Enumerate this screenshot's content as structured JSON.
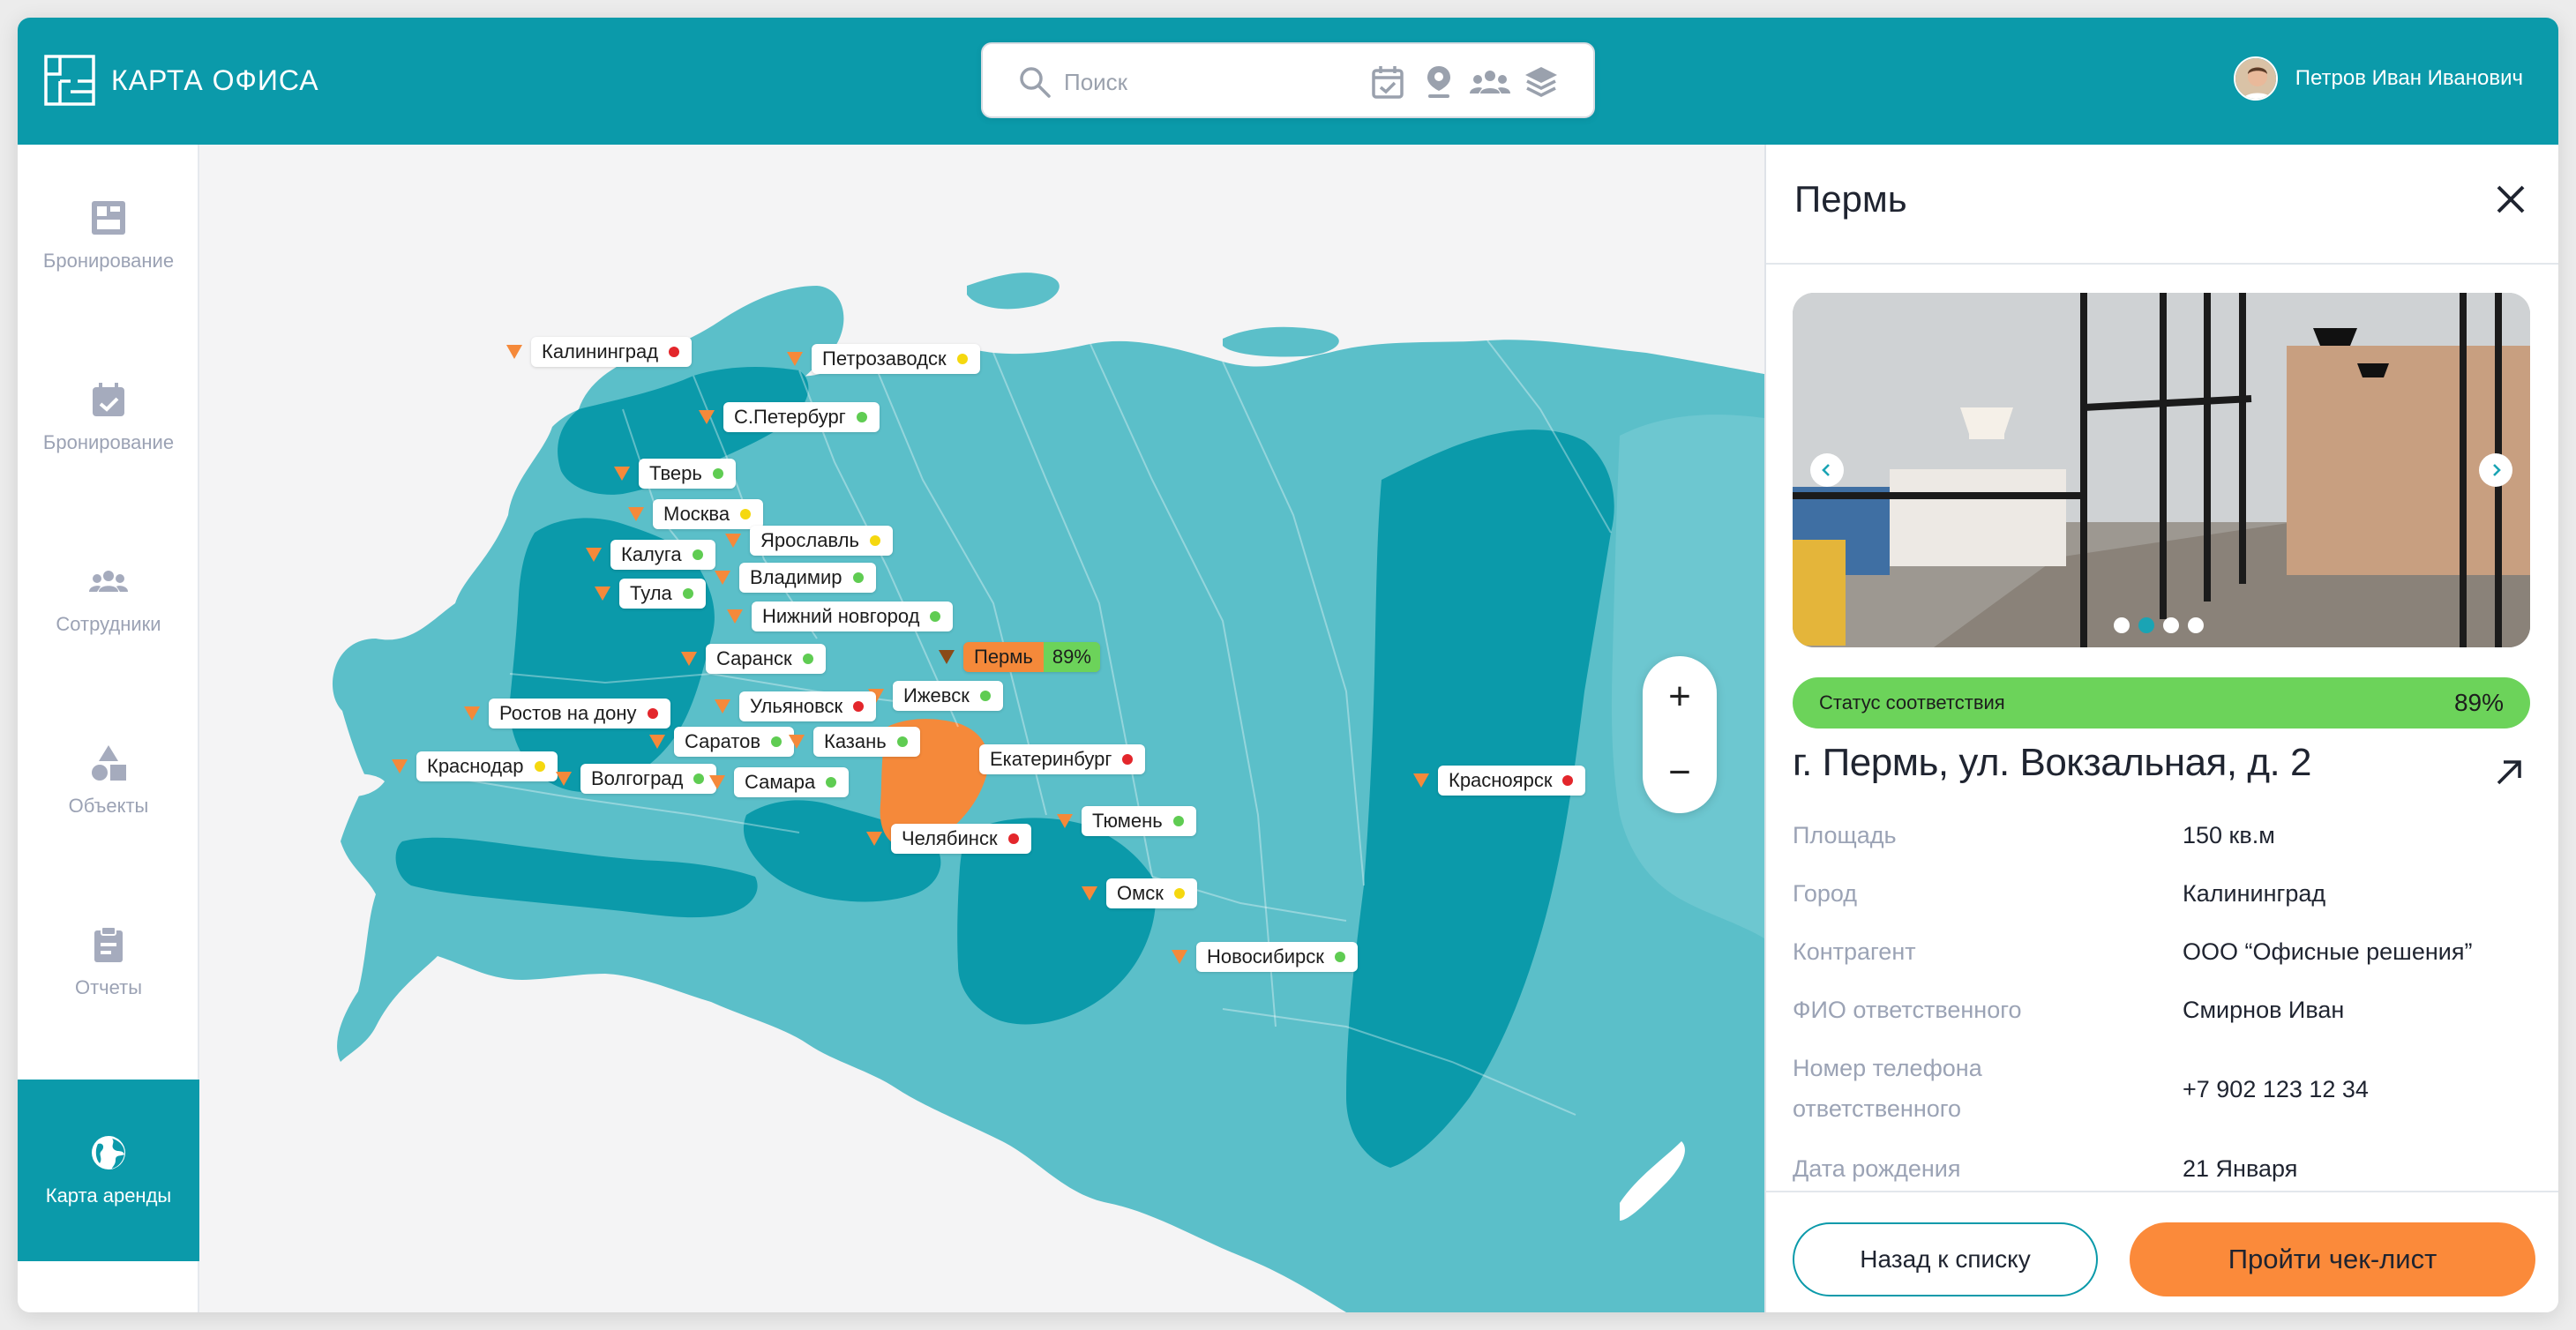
{
  "app": {
    "title": "КАРТА ОФИСА"
  },
  "search": {
    "placeholder": "Поиск",
    "tools": [
      "calendar-check-icon",
      "location-pin-icon",
      "people-icon",
      "layers-icon"
    ]
  },
  "user": {
    "name": "Петров Иван Иванович"
  },
  "sidebar": {
    "items": [
      {
        "label": "Бронирование",
        "icon": "floorplan-icon"
      },
      {
        "label": "Бронирование",
        "icon": "calendar-check-icon"
      },
      {
        "label": "Сотрудники",
        "icon": "people-icon"
      },
      {
        "label": "Объекты",
        "icon": "shapes-icon"
      },
      {
        "label": "Отчеты",
        "icon": "clipboard-icon"
      },
      {
        "label": "Карта аренды",
        "icon": "globe-icon",
        "active": true
      }
    ]
  },
  "map": {
    "cities": [
      {
        "name": "Калининград",
        "status": "red"
      },
      {
        "name": "Петрозаводск",
        "status": "yellow"
      },
      {
        "name": "С.Петербург",
        "status": "green"
      },
      {
        "name": "Тверь",
        "status": "green"
      },
      {
        "name": "Москва",
        "status": "yellow"
      },
      {
        "name": "Ярославль",
        "status": "yellow"
      },
      {
        "name": "Калуга",
        "status": "green"
      },
      {
        "name": "Владимир",
        "status": "green"
      },
      {
        "name": "Тула",
        "status": "green"
      },
      {
        "name": "Нижний новгород",
        "status": "green"
      },
      {
        "name": "Саранск",
        "status": "green"
      },
      {
        "name": "Пермь",
        "status": "selected",
        "percent": "89%"
      },
      {
        "name": "Ижевск",
        "status": "green"
      },
      {
        "name": "Ростов на дону",
        "status": "red"
      },
      {
        "name": "Ульяновск",
        "status": "red"
      },
      {
        "name": "Саратов",
        "status": "green"
      },
      {
        "name": "Казань",
        "status": "green"
      },
      {
        "name": "Екатеринбург",
        "status": "red"
      },
      {
        "name": "Краснодар",
        "status": "yellow"
      },
      {
        "name": "Волгоград",
        "status": "green"
      },
      {
        "name": "Самара",
        "status": "green"
      },
      {
        "name": "Красноярск",
        "status": "red"
      },
      {
        "name": "Тюмень",
        "status": "green"
      },
      {
        "name": "Челябинск",
        "status": "red"
      },
      {
        "name": "Омск",
        "status": "yellow"
      },
      {
        "name": "Новосибирск",
        "status": "green"
      }
    ],
    "zoom_in": "+",
    "zoom_out": "−"
  },
  "colors": {
    "accent": "#0b9aaa",
    "region": "#5bbfc9",
    "region_dark": "#0b9aaa",
    "selected": "#f5893a",
    "green": "#5fcc52",
    "yellow": "#f5d80f",
    "red": "#e3262b"
  },
  "panel": {
    "title": "Пермь",
    "gallery": {
      "slide_count": 4,
      "active_slide": 2
    },
    "status_label": "Статус соответствия",
    "status_value": "89%",
    "status_fraction": 0.89,
    "address": "г. Пермь, ул. Вокзальная, д. 2",
    "info": [
      {
        "key": "Площадь",
        "value": "150 кв.м"
      },
      {
        "key": "Город",
        "value": "Калининград"
      },
      {
        "key": "Контрагент",
        "value": "ООО “Офисные решения”"
      },
      {
        "key": "ФИО ответственного",
        "value": "Смирнов Иван"
      },
      {
        "key": "Номер телефона ответственного",
        "value": "+7 902 123 12 34"
      },
      {
        "key": "Дата рождения",
        "value": "21 Января"
      }
    ],
    "back_button": "Назад к списку",
    "checklist_button": "Пройти чек-лист"
  }
}
